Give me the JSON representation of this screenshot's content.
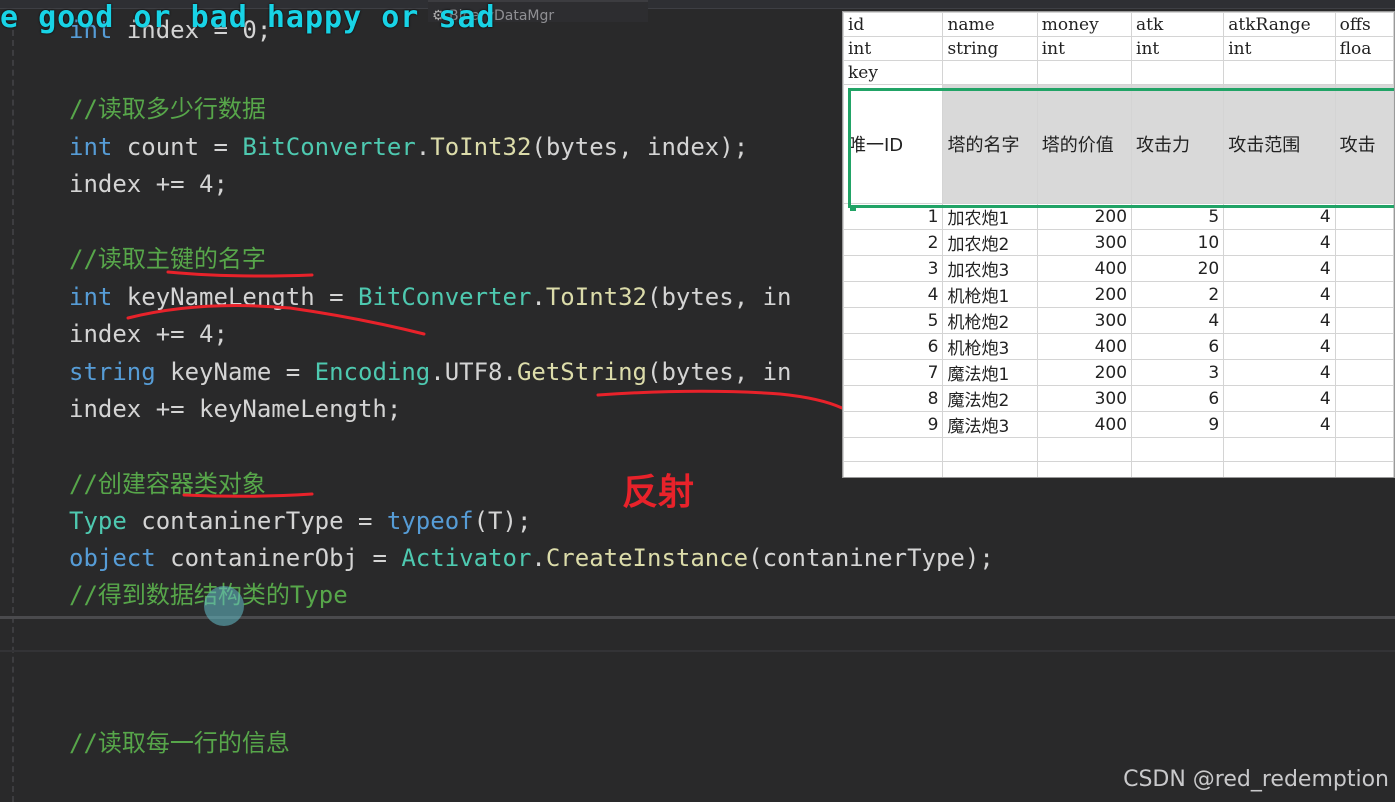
{
  "editor": {
    "tab_label": "BinaryDataMgr",
    "tab_right_text": "",
    "lines": [
      {
        "tokens": [
          {
            "t": "int",
            "c": "kw"
          },
          {
            "t": " index = 0;",
            "c": "id"
          }
        ]
      },
      {
        "tokens": []
      },
      {
        "tokens": [
          {
            "t": "//读取多少行数据",
            "c": "cm"
          }
        ]
      },
      {
        "tokens": [
          {
            "t": "int",
            "c": "kw"
          },
          {
            "t": " count = ",
            "c": "id"
          },
          {
            "t": "BitConverter",
            "c": "ty"
          },
          {
            "t": ".",
            "c": "id"
          },
          {
            "t": "ToInt32",
            "c": "fn"
          },
          {
            "t": "(bytes, index);",
            "c": "id"
          }
        ]
      },
      {
        "tokens": [
          {
            "t": "index += 4;",
            "c": "id"
          }
        ]
      },
      {
        "tokens": []
      },
      {
        "tokens": [
          {
            "t": "//读取主键的名字",
            "c": "cm"
          }
        ]
      },
      {
        "tokens": [
          {
            "t": "int",
            "c": "kw"
          },
          {
            "t": " keyNameLength = ",
            "c": "id"
          },
          {
            "t": "BitConverter",
            "c": "ty"
          },
          {
            "t": ".",
            "c": "id"
          },
          {
            "t": "ToInt32",
            "c": "fn"
          },
          {
            "t": "(bytes, in",
            "c": "id"
          }
        ]
      },
      {
        "tokens": [
          {
            "t": "index += 4;",
            "c": "id"
          }
        ]
      },
      {
        "tokens": [
          {
            "t": "string",
            "c": "kw"
          },
          {
            "t": " keyName = ",
            "c": "id"
          },
          {
            "t": "Encoding",
            "c": "ty"
          },
          {
            "t": ".UTF8.",
            "c": "id"
          },
          {
            "t": "GetString",
            "c": "fn"
          },
          {
            "t": "(bytes, in",
            "c": "id"
          }
        ]
      },
      {
        "tokens": [
          {
            "t": "index += keyNameLength;",
            "c": "id"
          }
        ]
      },
      {
        "tokens": []
      },
      {
        "tokens": [
          {
            "t": "//创建容器类对象",
            "c": "cm"
          }
        ]
      },
      {
        "tokens": [
          {
            "t": "Type",
            "c": "ty"
          },
          {
            "t": " contaninerType = ",
            "c": "id"
          },
          {
            "t": "typeof",
            "c": "kw"
          },
          {
            "t": "(T);",
            "c": "id"
          }
        ]
      },
      {
        "tokens": [
          {
            "t": "object",
            "c": "kw"
          },
          {
            "t": " contaninerObj = ",
            "c": "id"
          },
          {
            "t": "Activator",
            "c": "ty"
          },
          {
            "t": ".",
            "c": "id"
          },
          {
            "t": "CreateInstance",
            "c": "fn"
          },
          {
            "t": "(contaninerType);",
            "c": "id"
          }
        ]
      },
      {
        "tokens": [
          {
            "t": "//得到数据结构类的Type",
            "c": "cm"
          }
        ]
      }
    ],
    "bottom_comment": "//读取每一行的信息"
  },
  "subtitle": "e good or bad happy or sad",
  "annotation": "反射",
  "spreadsheet": {
    "header_rows": [
      [
        "id",
        "name",
        "money",
        "atk",
        "atkRange",
        "offs"
      ],
      [
        "int",
        "string",
        "int",
        "int",
        "int",
        "floa"
      ],
      [
        "key",
        "",
        "",
        "",
        "",
        ""
      ]
    ],
    "description_row": [
      "唯一ID",
      "塔的名字",
      "塔的价值",
      "攻击力",
      "攻击范围",
      "攻击"
    ],
    "data_rows": [
      [
        "1",
        "加农炮1",
        "200",
        "5",
        "4",
        ""
      ],
      [
        "2",
        "加农炮2",
        "300",
        "10",
        "4",
        ""
      ],
      [
        "3",
        "加农炮3",
        "400",
        "20",
        "4",
        ""
      ],
      [
        "4",
        "机枪炮1",
        "200",
        "2",
        "4",
        ""
      ],
      [
        "5",
        "机枪炮2",
        "300",
        "4",
        "4",
        ""
      ],
      [
        "6",
        "机枪炮3",
        "400",
        "6",
        "4",
        ""
      ],
      [
        "7",
        "魔法炮1",
        "200",
        "3",
        "4",
        ""
      ],
      [
        "8",
        "魔法炮2",
        "300",
        "6",
        "4",
        ""
      ],
      [
        "9",
        "魔法炮3",
        "400",
        "9",
        "4",
        ""
      ]
    ],
    "empty_rows": 3
  },
  "watermark": "CSDN @red_redemption",
  "colors": {
    "keyword": "#569cd6",
    "type": "#4ec9b0",
    "method": "#dcdcaa",
    "comment": "#57a64a",
    "text": "#d4d4d4",
    "subtitle": "#18d3e6",
    "annotation_red": "#e8222a",
    "selection_green": "#21a366"
  }
}
